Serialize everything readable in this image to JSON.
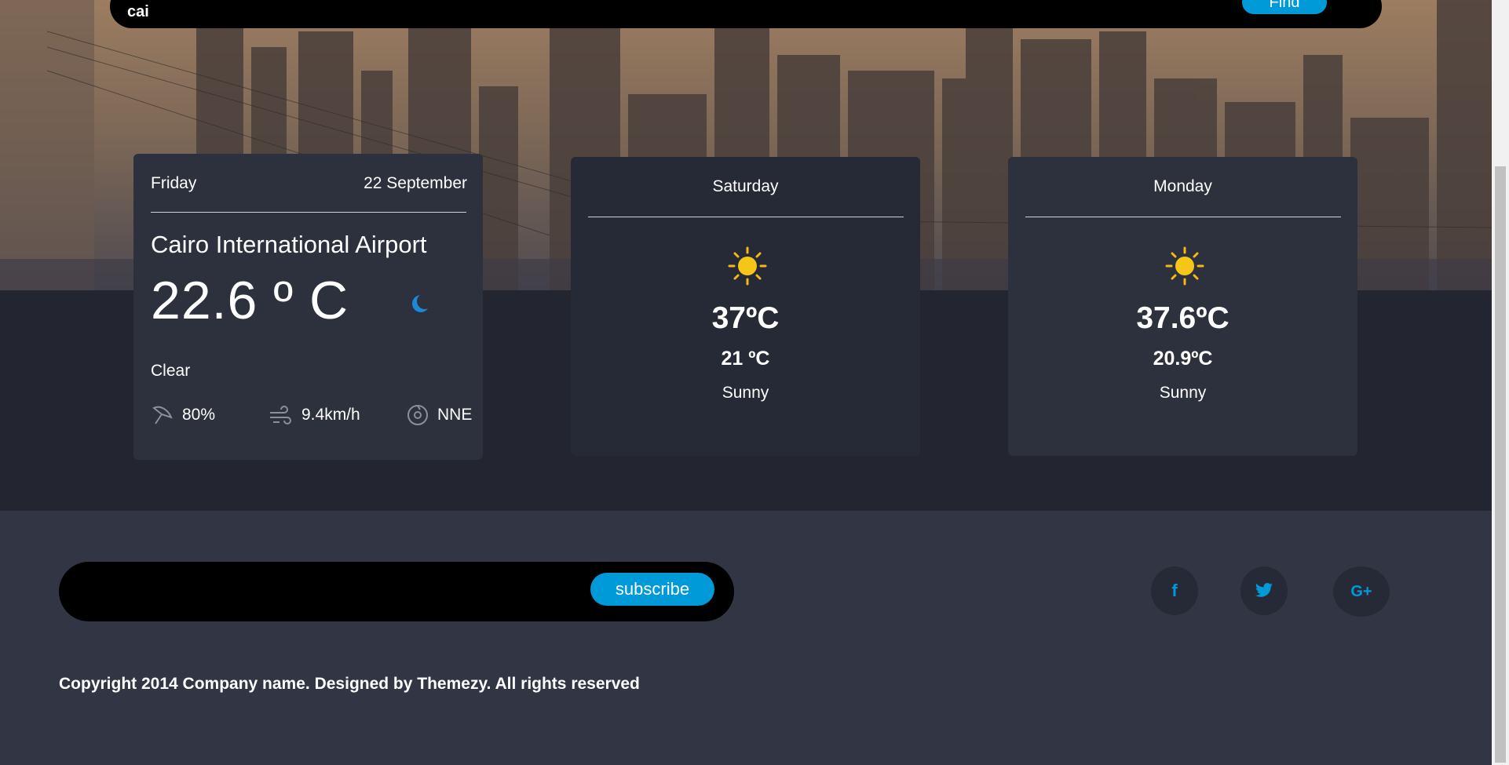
{
  "search": {
    "value": "cai",
    "find_label": "Find"
  },
  "today": {
    "day": "Friday",
    "date": "22 September",
    "location": "Cairo International Airport",
    "temperature": "22.6 º C",
    "condition": "Clear",
    "humidity": "80%",
    "wind_speed": "9.4km/h",
    "wind_direction": "NNE",
    "icon": "moon-icon"
  },
  "forecast": [
    {
      "day": "Saturday",
      "max": "37ºC",
      "min": "21 ºC",
      "condition": "Sunny",
      "icon": "sun-icon"
    },
    {
      "day": "Monday",
      "max": "37.6ºC",
      "min": "20.9ºC",
      "condition": "Sunny",
      "icon": "sun-icon"
    }
  ],
  "footer": {
    "subscribe_label": "subscribe",
    "social": {
      "facebook": "f",
      "twitter": "twitter-icon",
      "googleplus": "G+"
    },
    "copyright": "Copyright 2014 Company name. Designed by Themezy. All rights reserved"
  },
  "colors": {
    "accent": "#009ad8",
    "card": "#2d303d",
    "dark_band": "#232530",
    "footer": "#323544"
  }
}
